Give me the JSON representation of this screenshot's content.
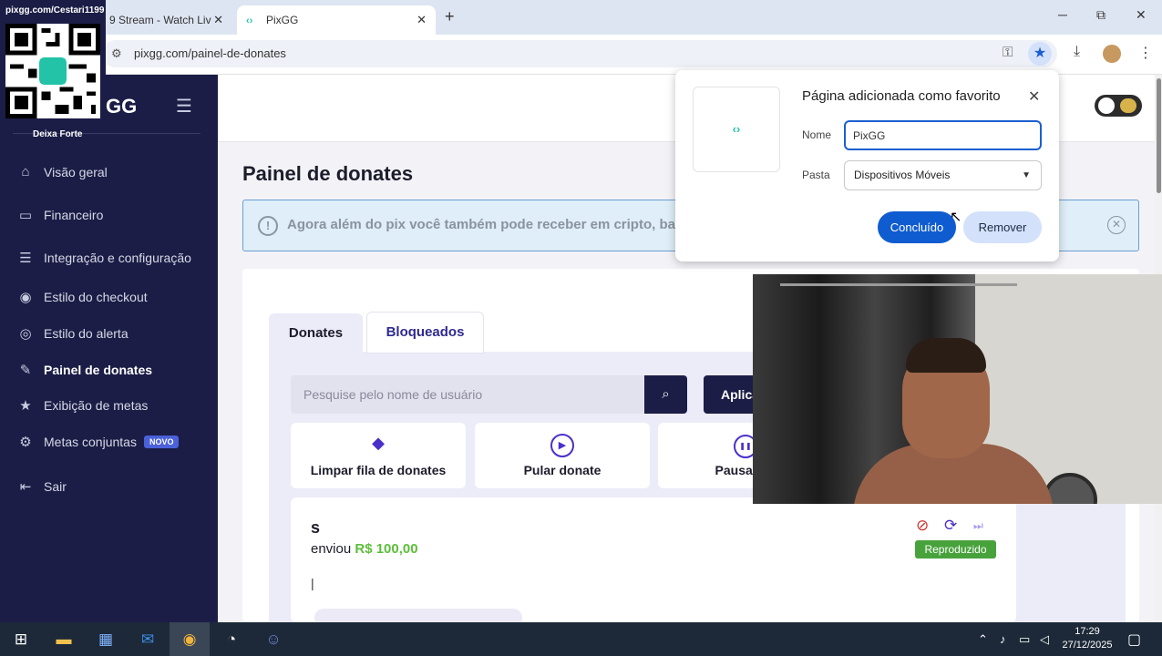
{
  "browser": {
    "tabs": [
      {
        "label": "9 Stream - Watch Liv",
        "close": "✕"
      },
      {
        "label": "PixGG",
        "close": "✕"
      }
    ],
    "new_tab": "+",
    "window_controls": {
      "minimize": "─",
      "maximize": "⧉",
      "close": "✕"
    },
    "url": "pixgg.com/painel-de-donates",
    "icons": {
      "site_info": "site-info-icon",
      "key": "key-icon",
      "bookmark": "star-icon",
      "download": "download-icon",
      "menu": "kebab-menu-icon"
    }
  },
  "qr_overlay": {
    "label": "pixgg.com/Cestari1199"
  },
  "sidebar": {
    "logo": "GG",
    "user": "Deixa Forte",
    "items": [
      {
        "label": "Visão geral",
        "icon": "⌂"
      },
      {
        "label": "Financeiro",
        "icon": "▭"
      },
      {
        "label": "Integração e configuração",
        "icon": "☰"
      },
      {
        "label": "Estilo do checkout",
        "icon": "◉"
      },
      {
        "label": "Estilo do alerta",
        "icon": "◎"
      },
      {
        "label": "Painel de donates",
        "icon": "✎"
      },
      {
        "label": "Exibição de metas",
        "icon": "★"
      },
      {
        "label": "Metas conjuntas",
        "icon": "⚙",
        "badge": "NOVO"
      },
      {
        "label": "Sair",
        "icon": "⇤"
      }
    ]
  },
  "main": {
    "title": "Painel de donates",
    "banner": {
      "text": "Agora além do pix você também pode receber em cripto, bas",
      "icon": "!",
      "close": "✕"
    },
    "tabs": {
      "donates": "Donates",
      "bloqueados": "Bloqueados"
    },
    "search": {
      "placeholder": "Pesquise pelo nome de usuário",
      "button_icon": "⌕"
    },
    "apply_label": "Aplica",
    "actions": [
      {
        "label": "Limpar fila de donates",
        "icon": "◆"
      },
      {
        "label": "Pular donate",
        "icon": "▶"
      },
      {
        "label": "Pausar os",
        "icon": "❚❚"
      }
    ],
    "donate": {
      "name": "s",
      "sent_prefix": "enviou",
      "amount": "R$ 100,00",
      "message": "|",
      "status": "Reproduzido",
      "icons": {
        "block": "⊘",
        "replay": "⟳",
        "skip": "⏭"
      }
    }
  },
  "bookmark_popup": {
    "title": "Página adicionada como favorito",
    "close": "✕",
    "thumb_icon": "‹›",
    "name_label": "Nome",
    "name_value": "PixGG",
    "folder_label": "Pasta",
    "folder_value": "Dispositivos Móveis",
    "done_label": "Concluído",
    "remove_label": "Remover"
  },
  "taskbar": {
    "time": "17:29",
    "date": "27/12/2025"
  },
  "colors": {
    "sidebar_bg": "#1b1d46",
    "accent": "#4b2fc9",
    "amount": "#5cbf3a",
    "status": "#48a23c",
    "chrome_blue": "#0f5cd0"
  }
}
